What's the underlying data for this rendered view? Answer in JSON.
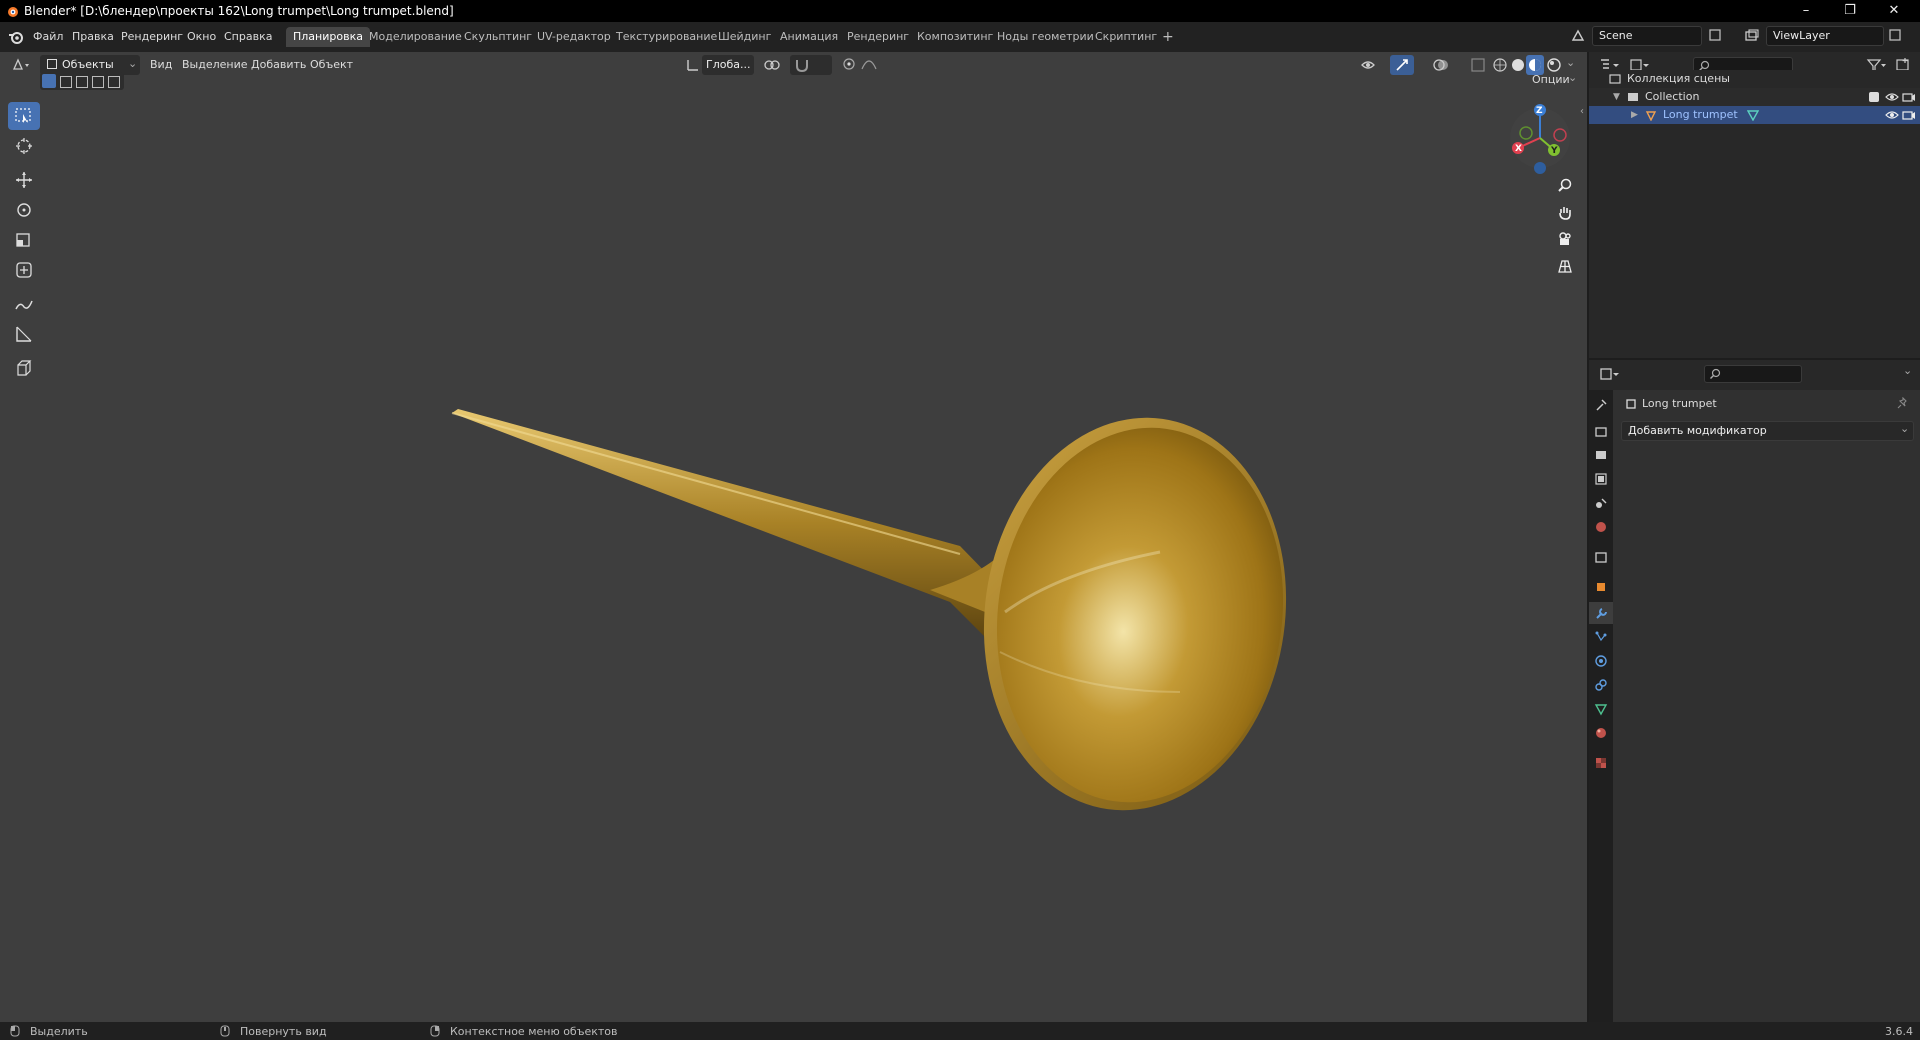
{
  "window": {
    "title": "Blender* [D:\\блендер\\проекты 162\\Long trumpet\\Long trumpet.blend]",
    "minimize": "–",
    "maximize": "❐",
    "close": "✕"
  },
  "menu": {
    "items": [
      "Файл",
      "Правка",
      "Рендеринг",
      "Окно",
      "Справка"
    ]
  },
  "workspaces": {
    "tabs": [
      "Планировка",
      "Моделирование",
      "Скульптинг",
      "UV-редактор",
      "Текстурирование",
      "Шейдинг",
      "Анимация",
      "Рендеринг",
      "Композитинг",
      "Ноды геометрии",
      "Скриптинг"
    ],
    "active": "Планировка",
    "add": "+"
  },
  "scene": {
    "name": "Scene",
    "view_layer": "ViewLayer"
  },
  "viewport_header": {
    "mode": "Объекты",
    "menus": [
      "Вид",
      "Выделение",
      "Добавить",
      "Объект"
    ],
    "transform_orientation": "Глоба...",
    "options": "Опции"
  },
  "gizmo": {
    "x": "X",
    "y": "Y",
    "z": "Z"
  },
  "outliner": {
    "scene_collection": "Коллекция сцены",
    "collection": "Collection",
    "object": "Long trumpet"
  },
  "properties": {
    "object_name": "Long trumpet",
    "add_modifier": "Добавить модификатор"
  },
  "statusbar": {
    "select": "Выделить",
    "rotate": "Повернуть вид",
    "context_menu": "Контекстное меню объектов",
    "version": "3.6.4"
  },
  "colors": {
    "accent": "#4772b3",
    "viewport_bg": "#3e3e3e",
    "brass": "#b08a2a",
    "axis_x": "#e0404f",
    "axis_y": "#80c030",
    "axis_z": "#3b7fd6"
  }
}
